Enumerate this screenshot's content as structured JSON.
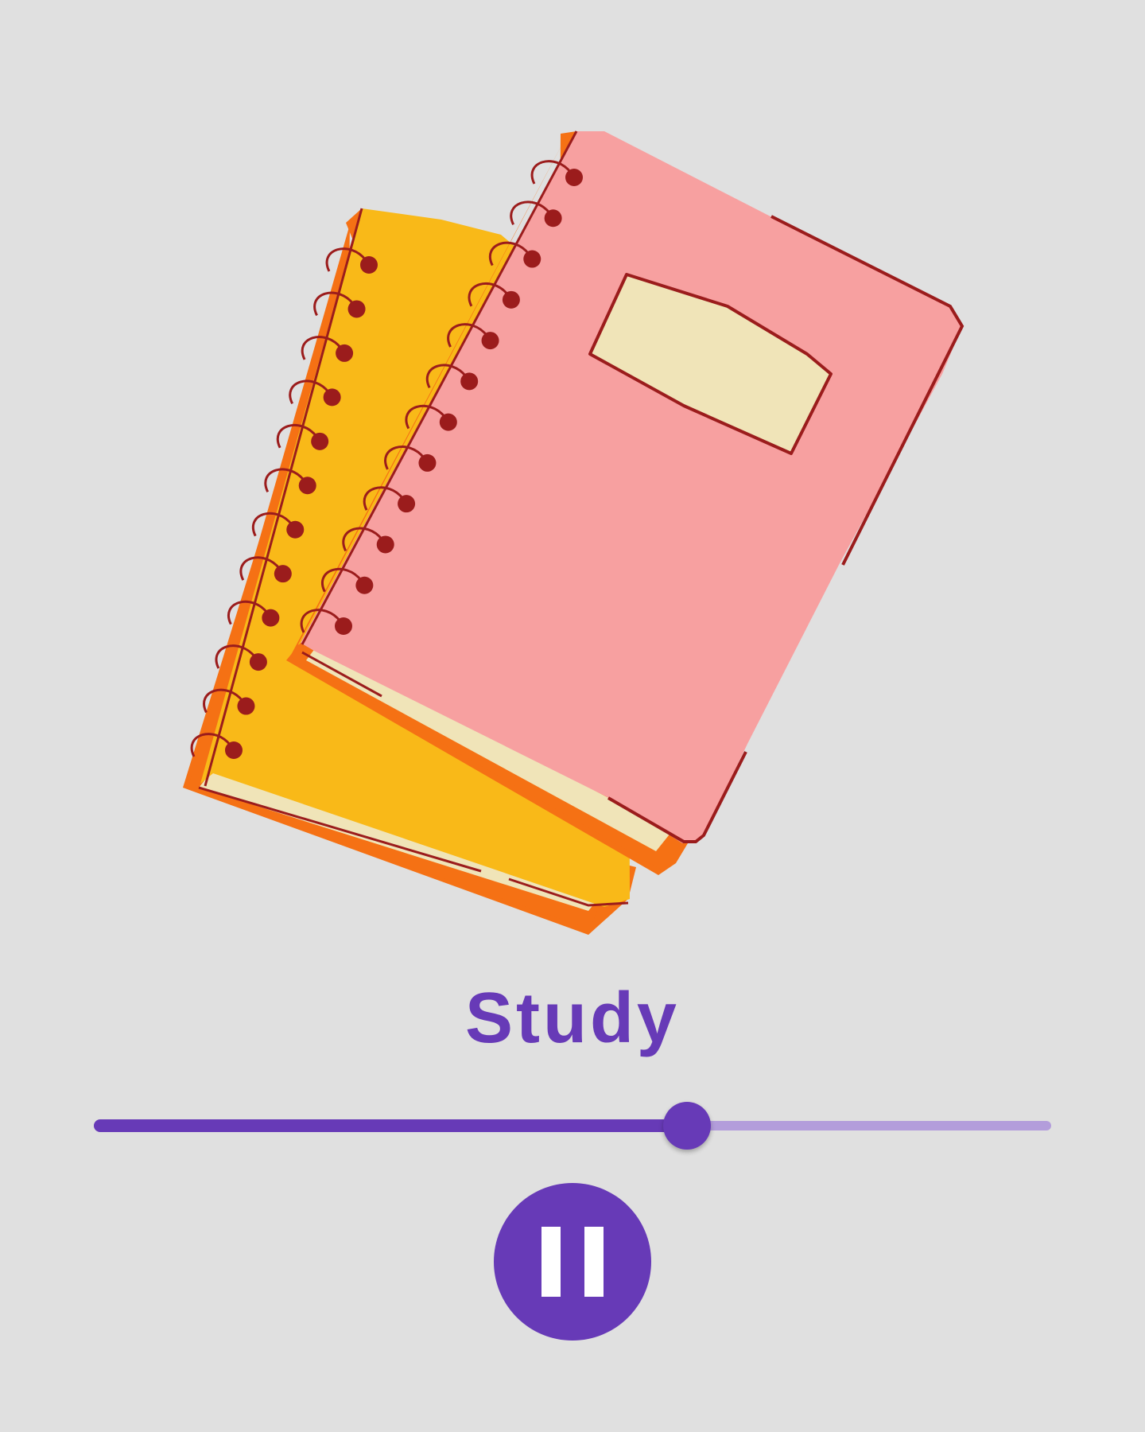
{
  "illustration": {
    "icon": "notebooks-illustration",
    "colors": {
      "background": "#e0e0e0",
      "pink_cover": "#f7a0a0",
      "yellow_cover": "#f9b918",
      "orange_edge": "#f57114",
      "paper": "#f0e4b8",
      "outline": "#9b1c1c"
    }
  },
  "title": "Study",
  "player": {
    "progress_percent": 62,
    "pause_icon": "pause-icon",
    "colors": {
      "accent": "#673ab7",
      "track_inactive": "#b39ddb"
    }
  }
}
